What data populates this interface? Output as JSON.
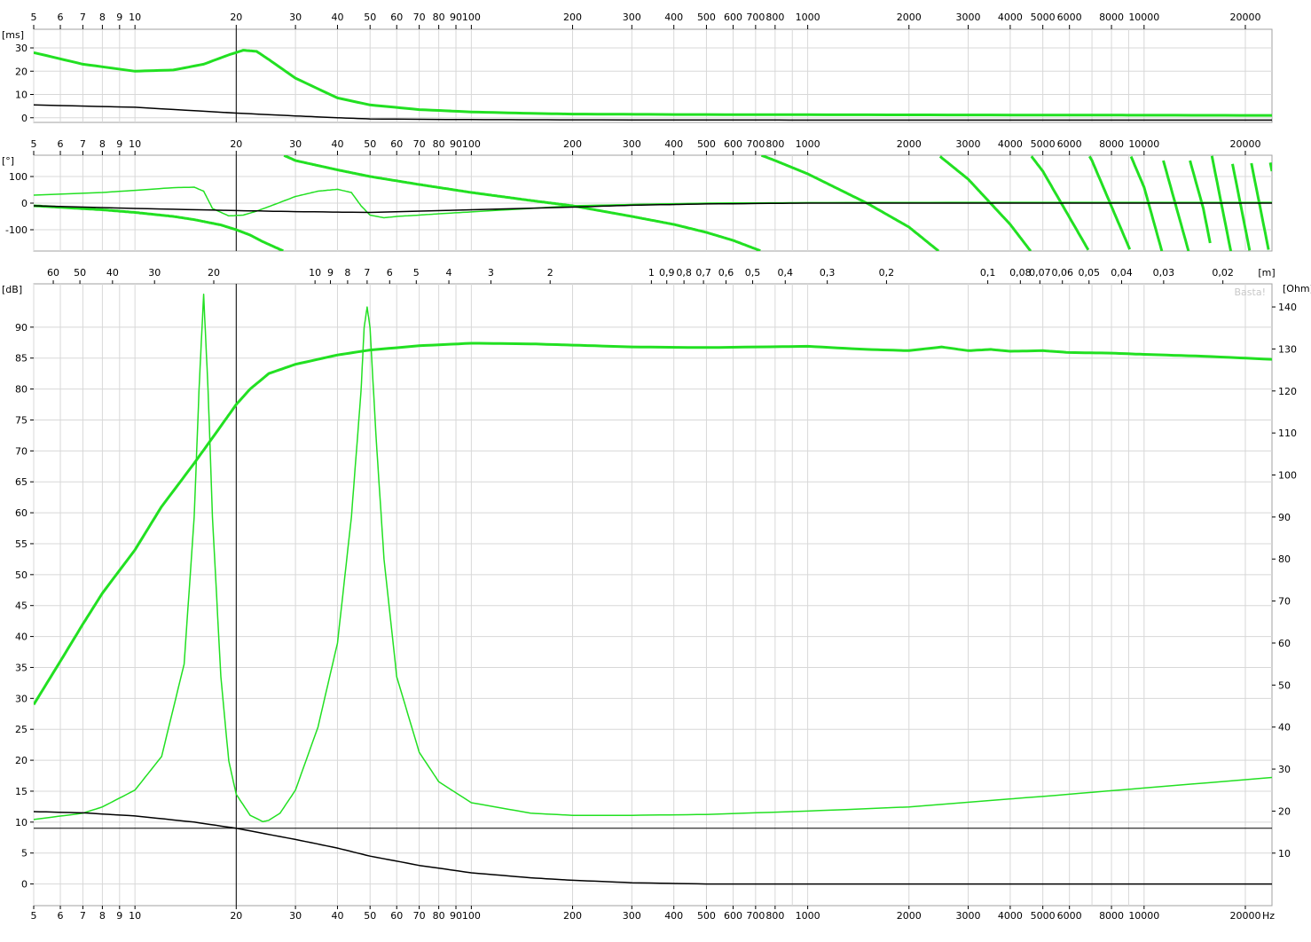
{
  "chart_data": [
    {
      "type": "line",
      "panel": "group-delay",
      "x_scale": "log",
      "xlim": [
        5,
        24000
      ],
      "x_ticks": [
        "5",
        "6",
        "7",
        "8",
        "9",
        "10",
        "20",
        "30",
        "40",
        "50",
        "60",
        "70",
        "80",
        "90",
        "100",
        "200",
        "300",
        "400",
        "500",
        "600",
        "700",
        "800",
        "1000",
        "2000",
        "3000",
        "4000",
        "5000",
        "6000",
        "8000",
        "10000",
        "20000"
      ],
      "y_unit_label": "[ms]",
      "ylim": [
        -2,
        38
      ],
      "y_ticks": [
        "0",
        "10",
        "20",
        "30"
      ],
      "cursor_x": 20,
      "grid": true,
      "series": [
        {
          "color": "#22e022",
          "width": 3,
          "x": [
            5,
            7,
            10,
            13,
            16,
            19,
            21,
            23,
            25,
            30,
            40,
            50,
            70,
            100,
            150,
            200,
            400,
            1000,
            3000,
            10000,
            24000
          ],
          "y": [
            28,
            23,
            20,
            20.5,
            23,
            27,
            29,
            28.5,
            25,
            17,
            8.5,
            5.5,
            3.5,
            2.5,
            1.9,
            1.6,
            1.4,
            1.3,
            1.2,
            1.1,
            1
          ]
        },
        {
          "color": "#000000",
          "width": 1.5,
          "x": [
            5,
            10,
            20,
            30,
            40,
            50,
            100,
            200,
            1000,
            24000
          ],
          "y": [
            5.5,
            4.5,
            2,
            0.8,
            0,
            -0.5,
            -0.8,
            -0.9,
            -1,
            -1
          ]
        }
      ]
    },
    {
      "type": "line",
      "panel": "phase",
      "x_scale": "log",
      "xlim": [
        5,
        24000
      ],
      "x_ticks": [
        "5",
        "6",
        "7",
        "8",
        "9",
        "10",
        "20",
        "30",
        "40",
        "50",
        "60",
        "70",
        "80",
        "90",
        "100",
        "200",
        "300",
        "400",
        "500",
        "600",
        "700",
        "800",
        "1000",
        "2000",
        "3000",
        "4000",
        "5000",
        "6000",
        "8000",
        "10000",
        "20000"
      ],
      "y_unit_label": "[°]",
      "ylim": [
        -180,
        180
      ],
      "y_ticks": [
        "-100",
        "0",
        "100"
      ],
      "cursor_x": 20,
      "grid": true,
      "series": [
        {
          "color": "#22e022",
          "width": 1.5,
          "x": [
            5,
            8,
            10,
            13,
            15,
            16,
            17,
            19,
            21,
            23,
            26,
            30,
            35,
            40,
            44,
            47,
            50,
            55,
            60,
            70,
            80,
            100,
            150,
            200,
            300,
            500,
            1000,
            3000,
            10000,
            24000
          ],
          "y": [
            30,
            40,
            48,
            58,
            60,
            45,
            -20,
            -48,
            -45,
            -30,
            -5,
            25,
            45,
            52,
            40,
            -10,
            -45,
            -55,
            -50,
            -45,
            -40,
            -33,
            -20,
            -10,
            -5,
            0,
            2,
            3,
            3,
            3
          ]
        },
        {
          "color": "#22e022",
          "width": 3,
          "wrapped": true,
          "x": [
            5,
            8,
            10,
            13,
            15,
            18,
            20,
            22,
            24,
            30,
            40,
            50,
            70,
            100,
            150,
            200,
            300,
            400,
            500,
            600,
            800,
            1000,
            1500,
            2000,
            3000,
            4000,
            5000,
            7000,
            10000,
            15000,
            24000
          ],
          "y": [
            -10,
            -25,
            -35,
            -50,
            -62,
            -82,
            -100,
            -120,
            -145,
            -200,
            -235,
            -260,
            -290,
            -320,
            -350,
            -370,
            -410,
            -440,
            -470,
            -500,
            -560,
            -610,
            -720,
            -810,
            -990,
            -1160,
            -1320,
            -1640,
            -2100,
            -2900,
            -4200
          ]
        },
        {
          "color": "#000000",
          "width": 1.5,
          "x": [
            5,
            10,
            20,
            30,
            50,
            100,
            200,
            300,
            500,
            1000,
            24000
          ],
          "y": [
            -10,
            -20,
            -28,
            -32,
            -35,
            -25,
            -15,
            -8,
            -3,
            0,
            0
          ]
        }
      ]
    },
    {
      "type": "line",
      "panel": "spl-impedance",
      "x_scale": "log",
      "xlim": [
        5,
        24000
      ],
      "x_ticks": [
        "5",
        "6",
        "7",
        "8",
        "9",
        "10",
        "20",
        "30",
        "40",
        "50",
        "60",
        "70",
        "80",
        "90",
        "100",
        "200",
        "300",
        "400",
        "500",
        "600",
        "700",
        "800",
        "1000",
        "2000",
        "3000",
        "4000",
        "5000",
        "6000",
        "8000",
        "10000",
        "20000"
      ],
      "x_unit": "Hz",
      "wavelength_ticks": [
        "60",
        "50",
        "40",
        "30",
        "20",
        "10",
        "9",
        "8",
        "7",
        "6",
        "5",
        "4",
        "3",
        "2",
        "1",
        "0,9",
        "0,8",
        "0,7",
        "0,6",
        "0,5",
        "0,4",
        "0,3",
        "0,2",
        "0,1",
        "0,08",
        "0,07",
        "0,06",
        "0,05",
        "0,04",
        "0,03",
        "0,02"
      ],
      "wavelength_unit": "[m]",
      "y_unit_label": "[dB]",
      "ylim": [
        -3.5,
        97
      ],
      "y_ticks": [
        "0",
        "5",
        "10",
        "15",
        "20",
        "25",
        "30",
        "35",
        "40",
        "45",
        "50",
        "55",
        "60",
        "65",
        "70",
        "75",
        "80",
        "85",
        "90"
      ],
      "y2_unit_label": "[Ohm]",
      "y2lim": [
        -2.5,
        145.5
      ],
      "y2_ticks": [
        "10",
        "20",
        "30",
        "40",
        "50",
        "60",
        "70",
        "80",
        "90",
        "100",
        "110",
        "120",
        "130",
        "140"
      ],
      "watermark": "Basta!",
      "cursor_x": 20,
      "cursor_y": 9,
      "grid": true,
      "series": [
        {
          "color": "#22e022",
          "width": 3,
          "axis": "left",
          "x": [
            5,
            6,
            7,
            8,
            10,
            12,
            15,
            18,
            20,
            22,
            25,
            30,
            40,
            50,
            70,
            100,
            150,
            200,
            300,
            500,
            1000,
            1500,
            2000,
            2500,
            3000,
            3500,
            4000,
            5000,
            6000,
            8000,
            10000,
            15000,
            24000
          ],
          "y": [
            29,
            36,
            42,
            47,
            54,
            61,
            68,
            74,
            77.5,
            80,
            82.5,
            84,
            85.5,
            86.3,
            87,
            87.4,
            87.3,
            87.1,
            86.8,
            86.7,
            86.9,
            86.4,
            86.2,
            86.8,
            86.2,
            86.4,
            86.1,
            86.2,
            85.9,
            85.8,
            85.6,
            85.3,
            84.8
          ]
        },
        {
          "color": "#22e022",
          "width": 1.5,
          "axis": "right",
          "x": [
            5,
            7,
            8,
            10,
            12,
            14,
            15,
            15.5,
            16,
            16.5,
            17,
            18,
            19,
            20,
            22,
            24,
            25,
            27,
            30,
            35,
            40,
            44,
            47,
            48,
            49,
            50,
            52,
            55,
            60,
            70,
            80,
            100,
            150,
            200,
            300,
            500,
            1000,
            2000,
            5000,
            10000,
            24000
          ],
          "y": [
            18,
            19.5,
            21,
            25,
            33,
            55,
            90,
            120,
            143,
            120,
            90,
            52,
            32,
            24,
            19,
            17.5,
            17.8,
            19.5,
            25,
            40,
            60,
            90,
            120,
            135,
            140,
            135,
            110,
            80,
            52,
            34,
            27,
            22,
            19.5,
            19,
            19,
            19.2,
            20,
            21,
            23.5,
            25.5,
            28
          ]
        },
        {
          "color": "#000000",
          "width": 1.5,
          "axis": "left",
          "x": [
            5,
            7,
            10,
            15,
            20,
            30,
            40,
            50,
            70,
            100,
            150,
            200,
            300,
            500,
            1000,
            24000
          ],
          "y": [
            11.7,
            11.5,
            11,
            10,
            9,
            7.2,
            5.8,
            4.5,
            3,
            1.8,
            1,
            0.6,
            0.2,
            0,
            0,
            0
          ]
        }
      ]
    }
  ]
}
